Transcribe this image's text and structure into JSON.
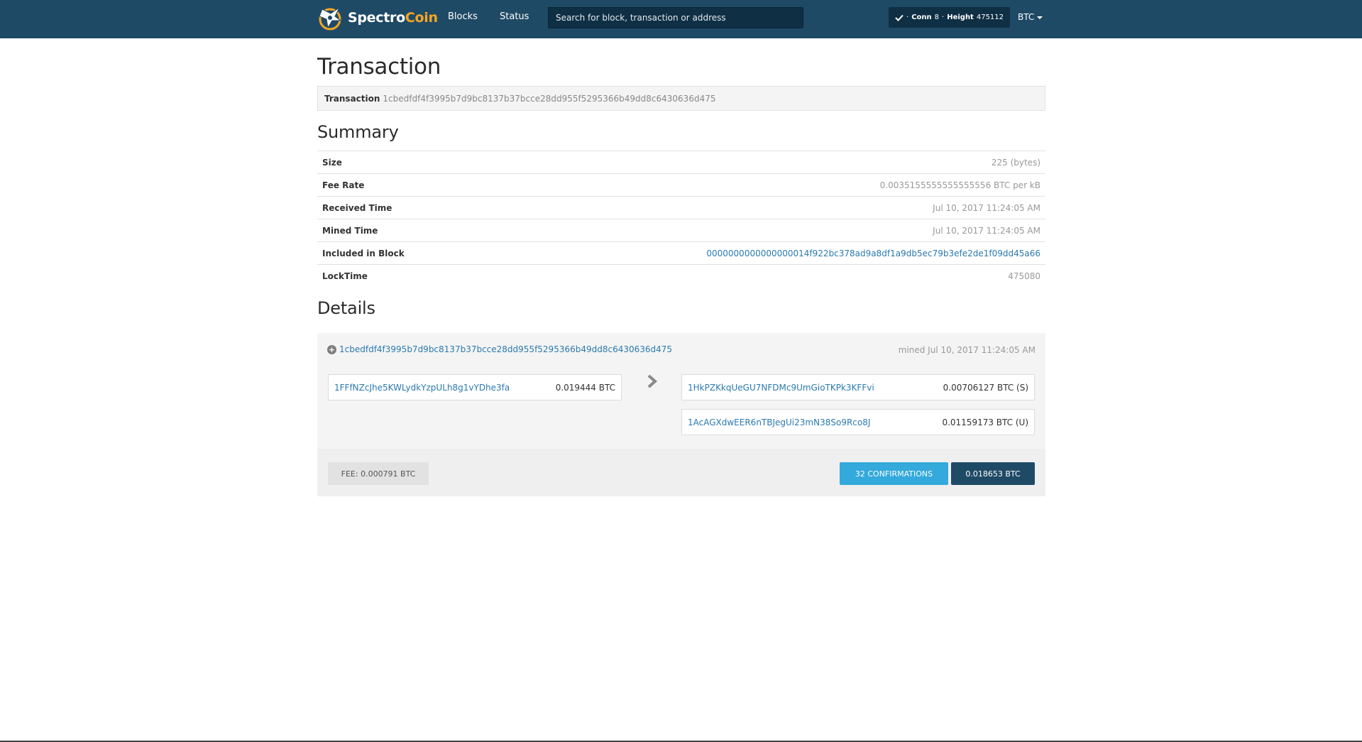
{
  "navbar": {
    "brand_part1": "Spectro",
    "brand_part2": "Coin",
    "nav_blocks": "Blocks",
    "nav_status": "Status",
    "search_placeholder": "Search for block, transaction or address",
    "conn_label": "Conn",
    "conn_value": "8",
    "height_label": "Height",
    "height_value": "475112",
    "currency": "BTC"
  },
  "page": {
    "title": "Transaction",
    "tx_label": "Transaction",
    "tx_hash": "1cbedfdf4f3995b7d9bc8137b37bcce28dd955f5295366b49dd8c6430636d475"
  },
  "summary": {
    "title": "Summary",
    "rows": [
      {
        "label": "Size",
        "value": "225 (bytes)"
      },
      {
        "label": "Fee Rate",
        "value": "0.0035155555555555556 BTC per kB"
      },
      {
        "label": "Received Time",
        "value": "Jul 10, 2017 11:24:05 AM"
      },
      {
        "label": "Mined Time",
        "value": "Jul 10, 2017 11:24:05 AM"
      },
      {
        "label": "Included in Block",
        "value": "0000000000000000014f922bc378ad9a8df1a9db5ec79b3efe2de1f09dd45a66"
      },
      {
        "label": "LockTime",
        "value": "475080"
      }
    ]
  },
  "details": {
    "title": "Details",
    "tx_hash": "1cbedfdf4f3995b7d9bc8137b37bcce28dd955f5295366b49dd8c6430636d475",
    "mined": "mined Jul 10, 2017 11:24:05 AM",
    "inputs": [
      {
        "address": "1FFfNZcJhe5KWLydkYzpULh8g1vYDhe3fa",
        "amount": "0.019444 BTC"
      }
    ],
    "outputs": [
      {
        "address": "1HkPZKkqUeGU7NFDMc9UmGioTKPk3KFFvi",
        "amount": "0.00706127 BTC (S)"
      },
      {
        "address": "1AcAGXdwEER6nTBJegUi23mN38So9Rco8J",
        "amount": "0.01159173 BTC (U)"
      }
    ],
    "fee": "FEE: 0.000791 BTC",
    "confirmations": "32 CONFIRMATIONS",
    "total": "0.018653 BTC"
  },
  "colors": {
    "navbar": "#1f4a66",
    "accent_orange": "#f5a623",
    "link": "#2a7ab0",
    "confirm": "#33a9dc"
  }
}
